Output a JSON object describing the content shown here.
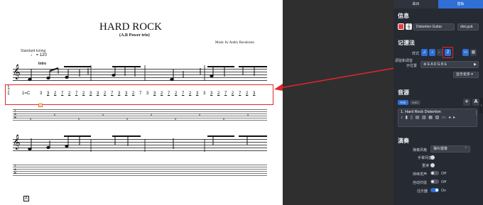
{
  "score": {
    "title": "HARD ROCK",
    "subtitle": "(A.R Power trio)",
    "composer": "Music by Andry Ravaloson",
    "tuning_label": "Standard tuning",
    "tempo": "= 120",
    "section": "Intro",
    "instrument_abbr": "dist.guit.",
    "key_label": "1=C",
    "tab_clef": "T A B",
    "rehearsal_mark": "A",
    "numbers_row": [
      {
        "t": "3",
        "u": false
      },
      {
        "t": "3",
        "u": true
      },
      {
        "t": "2",
        "u": true
      },
      {
        "t": "7",
        "u": true
      },
      {
        "t": "2",
        "u": true
      },
      {
        "t": "7",
        "u": true
      },
      {
        "t": "2",
        "u": true
      },
      {
        "t": "3",
        "u": true
      },
      {
        "t": "3",
        "u": true
      },
      {
        "t": "2",
        "u": true
      },
      {
        "t": "7",
        "u": true
      },
      {
        "t": "3",
        "u": true
      },
      {
        "t": "3",
        "u": true
      },
      {
        "t": "2",
        "u": true
      },
      {
        "t": "7",
        "u": false
      },
      {
        "t": "3",
        "u": false
      },
      {
        "t": "3",
        "u": true
      },
      {
        "t": "2",
        "u": true
      },
      {
        "t": "7",
        "u": true
      },
      {
        "t": "2",
        "u": true
      },
      {
        "t": "7",
        "u": true
      },
      {
        "t": "2",
        "u": true
      },
      {
        "t": "3",
        "u": true
      },
      {
        "t": "3",
        "u": false
      },
      {
        "t": "3",
        "u": true
      },
      {
        "t": "2",
        "u": true
      },
      {
        "t": "7",
        "u": true
      },
      {
        "t": "2",
        "u": true
      },
      {
        "t": "7",
        "u": true
      },
      {
        "t": "2",
        "u": true
      },
      {
        "t": "3",
        "u": true
      }
    ],
    "tab_row": [
      "0",
      "0",
      "0",
      "0",
      "0",
      "0",
      "0",
      "0",
      "0",
      "0"
    ]
  },
  "panel": {
    "tabs": [
      "曲目",
      "音轨"
    ],
    "info_title": "信息",
    "track_name": "Distortion Guitar",
    "track_abbr": "dist.guit.",
    "notation_title": "记谱法",
    "style_label": "样式",
    "tuning_label": "调弦和调音",
    "capo_label": "示位置",
    "tuning_value": "E A D G B E",
    "show_more": "显示更多",
    "sound_title": "音源",
    "sound_tabs": [
      "RSE",
      "MIDI"
    ],
    "sound_track": "1. Hard Rock Distortion",
    "play_title": "演奏",
    "strum_label": "弹奏风格",
    "strum_value": "弹片拨奏",
    "hand_mute_label": "手掌闷音",
    "rhythm_label": "重读",
    "sustain_label": "持续发声",
    "sustain_value": "Off",
    "vibrato_label": "自动扫弦",
    "vibrato_value": "Off",
    "amp_label": "往乐器",
    "amp_value": "On",
    "colors": {
      "accent": "#2f6fd6",
      "highlight": "#e0262e",
      "track_color": "#e8403a"
    }
  }
}
